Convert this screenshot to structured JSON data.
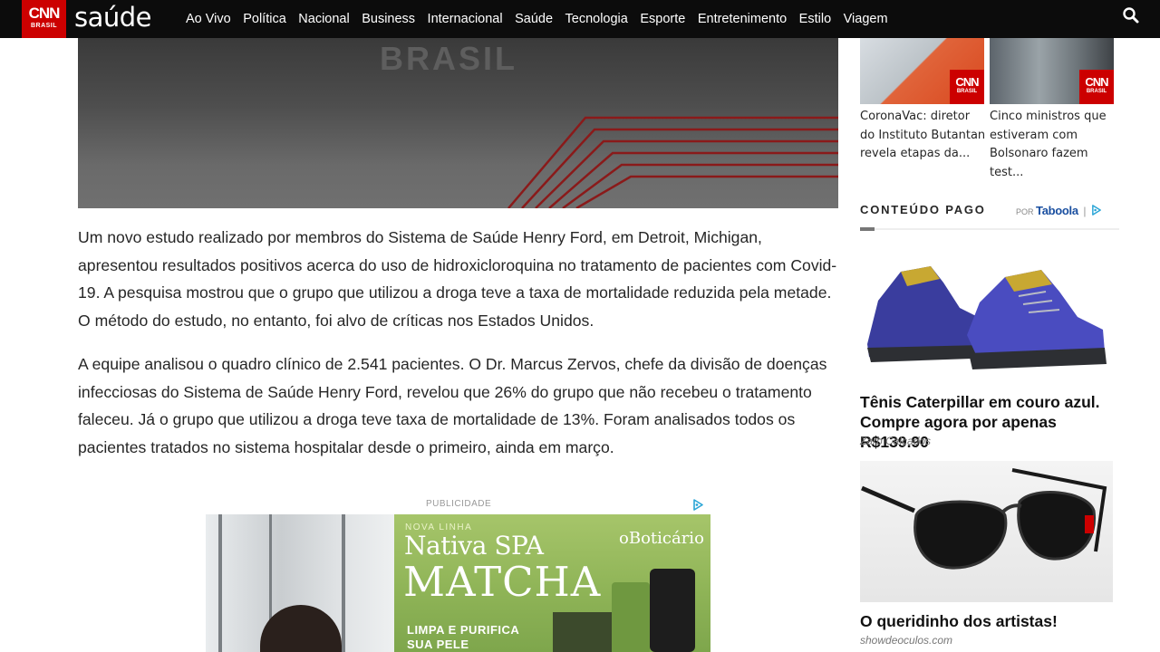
{
  "header": {
    "logo_cnn": "CNN",
    "logo_brasil": "BRASIL",
    "section": "saúde",
    "nav": [
      "Ao Vivo",
      "Política",
      "Nacional",
      "Business",
      "Internacional",
      "Saúde",
      "Tecnologia",
      "Esporte",
      "Entretenimento",
      "Estilo",
      "Viagem"
    ]
  },
  "hero": {
    "watermark": "BRASIL"
  },
  "article": {
    "paragraph_1": "Um novo estudo realizado por membros do Sistema de Saúde Henry Ford, em Detroit, Michigan, apresentou resultados positivos acerca do uso de hidroxicloroquina no tratamento de pacientes com Covid-19. A pesquisa mostrou que o grupo que utilizou a droga teve a taxa de mortalidade reduzida pela metade. O método do estudo, no entanto, foi alvo de críticas nos Estados Unidos.",
    "paragraph_2": "A equipe analisou o quadro clínico de 2.541 pacientes. O Dr. Marcus Zervos, chefe da divisão de doenças infecciosas do Sistema de Saúde Henry Ford, revelou que 26% do grupo que não recebeu o tratamento faleceu. Já o grupo que utilizou a droga teve taxa de mortalidade de 13%. Foram analisados todos os pacientes tratados no sistema hospitalar desde o primeiro, ainda em março."
  },
  "ad": {
    "label": "PUBLICIDADE",
    "kicker": "NOVA LINHA",
    "line1": "Nativa SPA",
    "line2": "MATCHA",
    "brand": "oBoticário",
    "tagline_1": "LIMPA E PURIFICA",
    "tagline_2": "SUA PELE"
  },
  "sidebar": {
    "related": [
      {
        "headline": "CoronaVac: diretor do Instituto Butantan revela etapas da..."
      },
      {
        "headline": "Cinco ministros que estiveram com Bolsonaro fazem test..."
      }
    ],
    "thumb_logo": {
      "cnn": "CNN",
      "brasil": "BRASIL"
    },
    "paid": {
      "title": "CONTEÚDO PAGO",
      "by": "POR",
      "provider": "Taboola",
      "separator": "|"
    },
    "sponsored": [
      {
        "title": "Tênis Caterpillar em couro azul. Compre agora por apenas R$139.90",
        "source": "Zarb Calçados"
      },
      {
        "title": "O queridinho dos artistas!",
        "source": "showdeoculos.com"
      }
    ]
  },
  "colors": {
    "brand_red": "#cc0000",
    "nav_bg": "#0c0c0c",
    "taboola_blue": "#1a4fa0"
  }
}
